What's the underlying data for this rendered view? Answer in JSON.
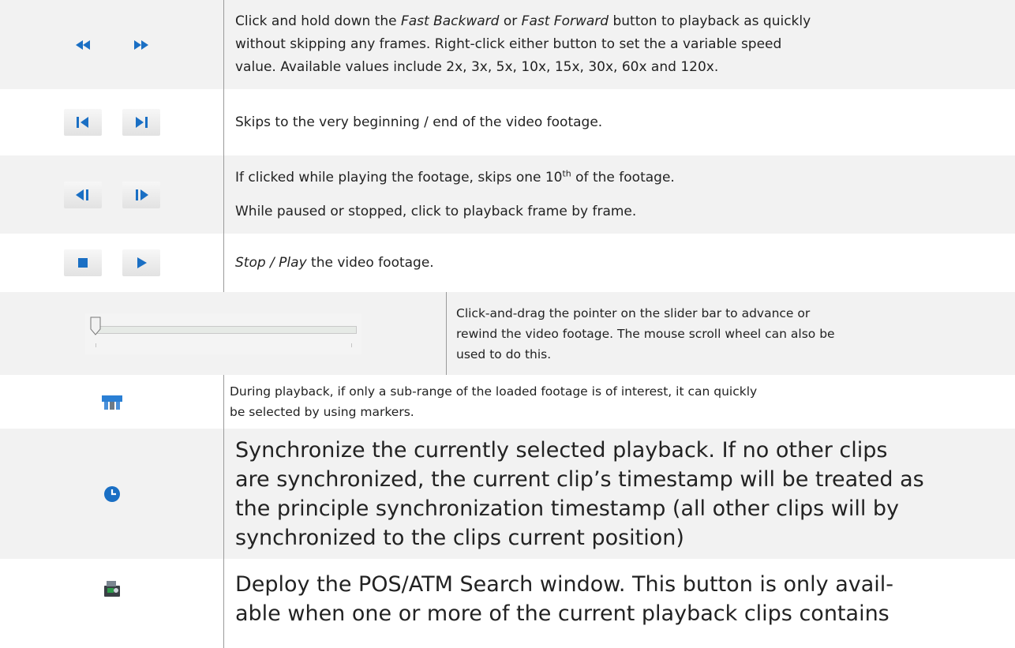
{
  "rows": {
    "fast": {
      "line1_a": "Click and hold down the ",
      "line1_b": "Fast Backward",
      "line1_c": " or ",
      "line1_d": "Fast Forward",
      "line1_e": " button to playback as quickly",
      "line2": "without skipping any frames.  Right-click either button to set the a variable speed",
      "line3": "value. Available values include 2x, 3x, 5x, 10x, 15x, 30x, 60x and 120x.",
      "icons": [
        "fast-backward-icon",
        "fast-forward-icon"
      ]
    },
    "skip": {
      "text": "Skips to the very beginning / end of the video footage.",
      "icons": [
        "skip-to-start-icon",
        "skip-to-end-icon"
      ]
    },
    "step": {
      "line1_a": "If clicked while playing the footage, skips one 10",
      "line1_sup": "th",
      "line1_b": " of the footage.",
      "line2": "While paused or stopped, click to playback frame by frame.",
      "icons": [
        "step-backward-icon",
        "step-forward-icon"
      ]
    },
    "stopplay": {
      "em": "Stop / Play",
      "rest": " the video footage.",
      "icons": [
        "stop-icon",
        "play-icon"
      ]
    },
    "slider": {
      "line1": "Click-and-drag the pointer on the slider bar to advance or",
      "line2": "rewind the video footage. The mouse scroll wheel can also be",
      "line3": "used to do this.",
      "position": 0.0
    },
    "markers": {
      "line1": "During playback, if only a sub-range of the loaded footage is of interest, it can quickly",
      "line2": "be selected by using markers.",
      "icon": "markers-icon"
    },
    "sync": {
      "line1": "Synchronize the currently selected playback. If no other clips",
      "line2": "are synchronized, the current clip’s timestamp will be treated as",
      "line3": "the principle synchronization timestamp (all other clips will by",
      "line4": "synchronized to the clips current position)",
      "icon": "clock-icon"
    },
    "pos": {
      "line1": "Deploy the POS/ATM Search window. This button is only avail-",
      "line2": "able when one or more of the current playback clips contains",
      "icon": "pos-atm-search-icon"
    }
  },
  "colors": {
    "accent": "#1a6fc4",
    "row_alt": "#f2f2f2"
  }
}
